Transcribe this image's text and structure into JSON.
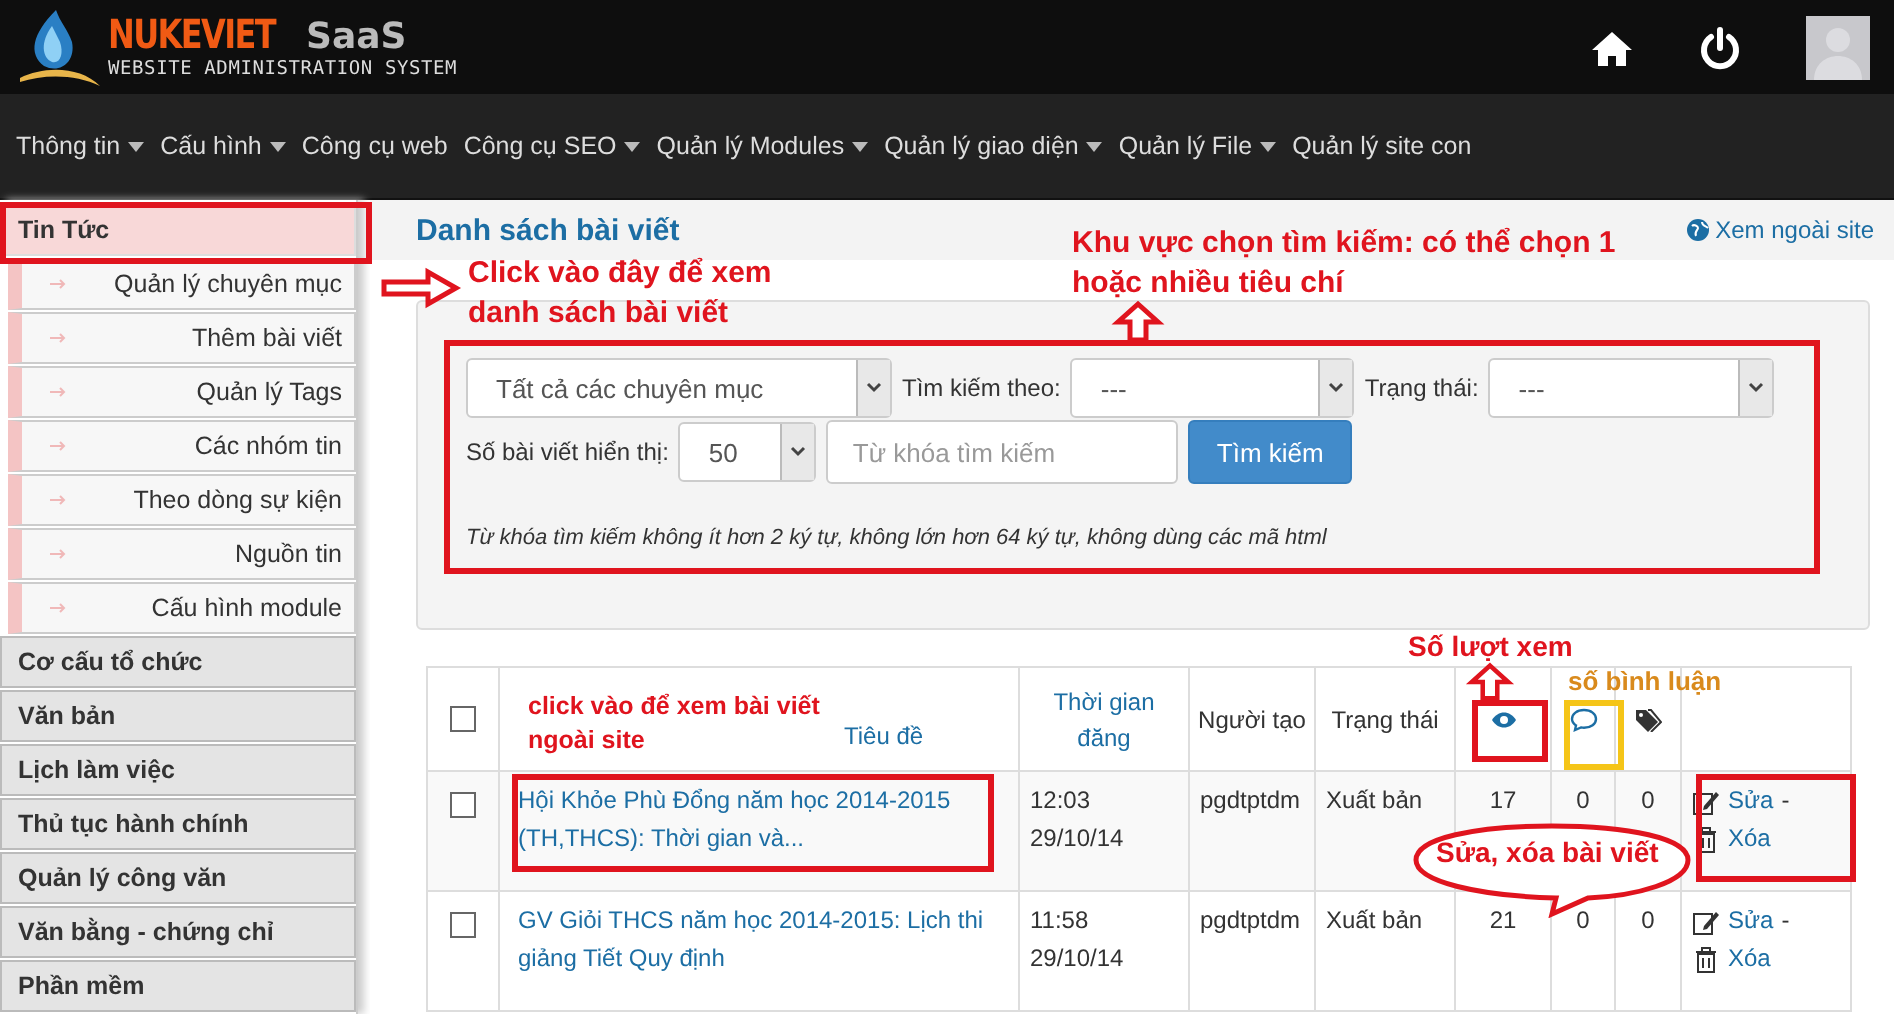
{
  "header": {
    "logo": {
      "brand": "NUKEVIET",
      "suffix": "SaaS",
      "tagline": "WEBSITE ADMINISTRATION SYSTEM"
    }
  },
  "nav": [
    {
      "label": "Thông tin",
      "has_menu": true
    },
    {
      "label": "Cấu hình",
      "has_menu": true
    },
    {
      "label": "Công cụ web",
      "has_menu": false
    },
    {
      "label": "Công cụ SEO",
      "has_menu": true
    },
    {
      "label": "Quản lý Modules",
      "has_menu": true
    },
    {
      "label": "Quản lý giao diện",
      "has_menu": true
    },
    {
      "label": "Quản lý File",
      "has_menu": true
    },
    {
      "label": "Quản lý site con",
      "has_menu": false
    }
  ],
  "sidebar": {
    "items": [
      {
        "label": "Tin Tức",
        "expanded": true,
        "children": [
          {
            "label": "Quản lý chuyên mục"
          },
          {
            "label": "Thêm bài viết"
          },
          {
            "label": "Quản lý Tags"
          },
          {
            "label": "Các nhóm tin"
          },
          {
            "label": "Theo dòng sự kiện"
          },
          {
            "label": "Nguồn tin"
          },
          {
            "label": "Cấu hình module"
          }
        ]
      },
      {
        "label": "Cơ cấu tổ chức",
        "expanded": false
      },
      {
        "label": "Văn bản",
        "expanded": false
      },
      {
        "label": "Lịch làm việc",
        "expanded": false
      },
      {
        "label": "Thủ tục hành chính",
        "expanded": false
      },
      {
        "label": "Quản lý công văn",
        "expanded": false
      },
      {
        "label": "Văn bằng - chứng chỉ",
        "expanded": false
      },
      {
        "label": "Phần mềm",
        "expanded": false
      }
    ]
  },
  "page": {
    "title": "Danh sách bài viết",
    "view_site_link": "Xem ngoài site"
  },
  "search": {
    "category": "Tất cả các chuyên mục",
    "search_by_label": "Tìm kiếm theo:",
    "search_by": "---",
    "status_label": "Trạng thái:",
    "status": "---",
    "per_page_label": "Số bài viết hiển thị:",
    "per_page": "50",
    "keyword_placeholder": "Từ khóa tìm kiếm",
    "button": "Tìm kiếm",
    "note": "Từ khóa tìm kiếm không ít hơn 2 ký tự, không lớn hơn 64 ký tự, không dùng các mã html"
  },
  "table": {
    "columns": [
      {
        "kind": "check",
        "checked": false
      },
      {
        "kind": "link",
        "label": "Tiêu đề"
      },
      {
        "kind": "link",
        "label": "Thời gian đăng"
      },
      {
        "kind": "text",
        "label": "Người tạo"
      },
      {
        "kind": "text",
        "label": "Trạng thái"
      },
      {
        "kind": "eye"
      },
      {
        "kind": "comment"
      },
      {
        "kind": "tag"
      },
      {
        "kind": "blank"
      }
    ],
    "rows": [
      {
        "checked": false,
        "title": "Hội Khỏe Phù Đổng năm học 2014-2015 (TH,THCS): Thời gian và...",
        "time": "12:03",
        "date": "29/10/14",
        "author": "pgdtptdm",
        "status": "Xuất bản",
        "views": "17",
        "comments": "0",
        "tags": "0",
        "edit": "Sửa",
        "separator": "-",
        "delete": "Xóa"
      },
      {
        "checked": false,
        "title": "GV Giỏi THCS năm học 2014-2015: Lịch thi giảng Tiết Quy định",
        "time": "11:58",
        "date": "29/10/14",
        "author": "pgdtptdm",
        "status": "Xuất bản",
        "views": "21",
        "comments": "0",
        "tags": "0",
        "edit": "Sửa",
        "separator": "-",
        "delete": "Xóa"
      }
    ]
  },
  "annotations": [
    {
      "kind": "box",
      "color": "#e0141e"
    },
    {
      "kind": "arrow",
      "color": "#e0141e"
    },
    {
      "kind": "note",
      "color": "#e0141e",
      "text": "Click vào đây để xem danh sách bài viết"
    },
    {
      "kind": "box",
      "color": "#e0141e"
    },
    {
      "kind": "note",
      "color": "#e0141e",
      "text": "Khu vực chọn tìm kiếm: có thể chọn 1 hoặc nhiều tiêu chí"
    },
    {
      "kind": "arrow",
      "color": "#e0141e"
    },
    {
      "kind": "note",
      "color": "#e0141e",
      "text": "click vào để xem bài viết ngoài site"
    },
    {
      "kind": "box",
      "color": "#e0141e"
    },
    {
      "kind": "note",
      "color": "#e0141e",
      "text": "Số lượt xem"
    },
    {
      "kind": "arrow",
      "color": "#e0141e"
    },
    {
      "kind": "box",
      "color": "#e0141e"
    },
    {
      "kind": "note",
      "color": "#d98a1c",
      "text": "số bình luận"
    },
    {
      "kind": "box",
      "color": "#f5c518"
    },
    {
      "kind": "box",
      "color": "#e0141e"
    },
    {
      "kind": "bubble",
      "color": "#e0141e",
      "text": "Sửa, xóa bài viết"
    }
  ]
}
